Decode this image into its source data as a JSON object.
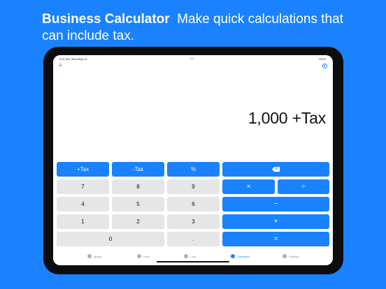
{
  "headline": {
    "bold": "Business Calculator",
    "rest": "Make quick calculations that can include tax."
  },
  "status": {
    "time": "8:37 AM",
    "date": "Wed May 19",
    "dots": "•••",
    "battery": "100%"
  },
  "display": {
    "value": "1,000 +Tax"
  },
  "keys": {
    "plus_tax": "+Tax",
    "minus_tax": "-Tax",
    "percent": "%",
    "k7": "7",
    "k8": "8",
    "k9": "9",
    "multiply": "×",
    "divide": "÷",
    "k4": "4",
    "k5": "5",
    "k6": "6",
    "minus": "−",
    "k1": "1",
    "k2": "2",
    "k3": "3",
    "plus": "+",
    "k0": "0",
    "dot": ".",
    "equals": "="
  },
  "tabs": [
    {
      "label": "Margin"
    },
    {
      "label": "Price"
    },
    {
      "label": "Cost"
    },
    {
      "label": "Calculator",
      "active": true
    },
    {
      "label": "Settings"
    }
  ],
  "colors": {
    "accent": "#1a82ff",
    "key_gray": "#e6e6e8",
    "bezel": "#0d0d0f"
  }
}
